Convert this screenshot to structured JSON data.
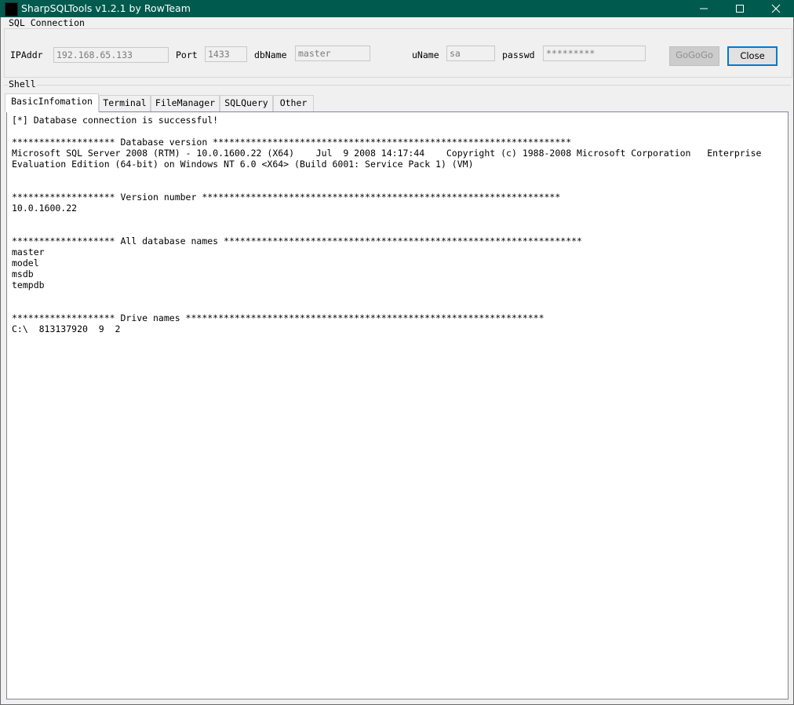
{
  "window": {
    "title": "SharpSQLTools v1.2.1 by RowTeam",
    "minimize_glyph": "—",
    "maximize_glyph": "☐",
    "close_glyph": "✕"
  },
  "connection": {
    "group_title": "SQL Connection",
    "ip_label": "IPAddr",
    "ip_value": "192.168.65.133",
    "port_label": "Port",
    "port_value": "1433",
    "db_label": "dbName",
    "db_value": "master",
    "uname_label": "uName",
    "uname_value": "sa",
    "passwd_label": "passwd",
    "passwd_value": "*********",
    "gogogo_label": "GoGoGo",
    "close_label": "Close"
  },
  "shell": {
    "group_title": "Shell",
    "tabs": [
      {
        "label": "BasicInfomation",
        "active": true
      },
      {
        "label": "Terminal",
        "active": false
      },
      {
        "label": "FileManager",
        "active": false
      },
      {
        "label": "SQLQuery",
        "active": false
      },
      {
        "label": "Other",
        "active": false
      }
    ],
    "output": "[*] Database connection is successful!\n\n******************* Database version ******************************************************************\nMicrosoft SQL Server 2008 (RTM) - 10.0.1600.22 (X64)    Jul  9 2008 14:17:44    Copyright (c) 1988-2008 Microsoft Corporation   Enterprise\nEvaluation Edition (64-bit) on Windows NT 6.0 <X64> (Build 6001: Service Pack 1) (VM)\n\n\n******************* Version number ******************************************************************\n10.0.1600.22\n\n\n******************* All database names ******************************************************************\nmaster\nmodel\nmsdb\ntempdb\n\n\n******************* Drive names ******************************************************************\nC:\\  813137920  9  2"
  },
  "colors": {
    "titlebar": "#005a4e",
    "focus_border": "#0078d7"
  }
}
